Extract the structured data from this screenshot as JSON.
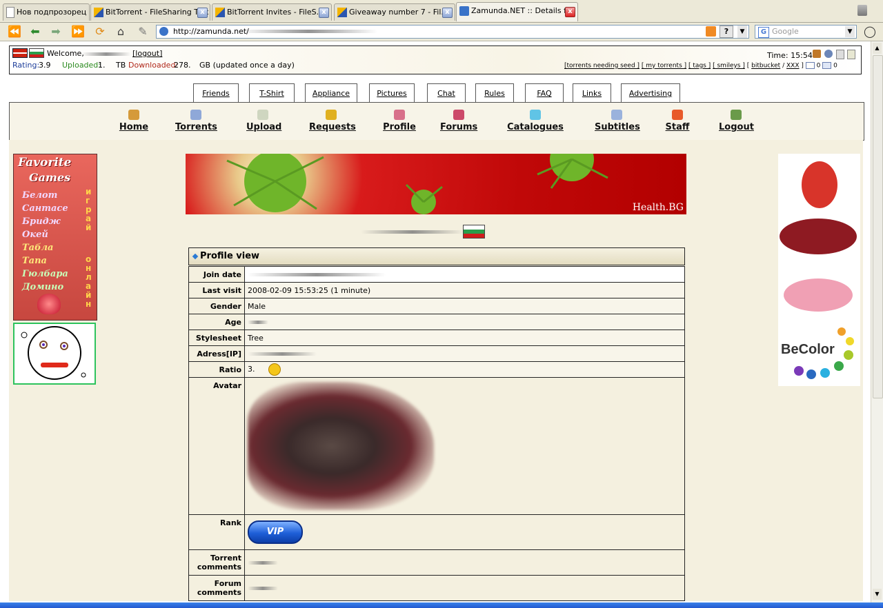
{
  "browser": {
    "tabs": [
      {
        "label": "Нов подпрозорец"
      },
      {
        "label": "BitTorrent - FileSharing Talk"
      },
      {
        "label": "BitTorrent Invites - FileS..."
      },
      {
        "label": "Giveaway number 7 - Fil..."
      },
      {
        "label": "Zamunda.NET :: Details f..."
      }
    ],
    "url": "http://zamunda.net/",
    "search_placeholder": "Google"
  },
  "header": {
    "welcome": "Welcome,",
    "logout": "[logout]",
    "rating_label": "Rating:",
    "rating_value": "3.9",
    "uploaded_label": "Uploaded:",
    "uploaded_value": "1.",
    "uploaded_unit": "TB",
    "downloaded_label": "Downloaded:",
    "downloaded_value": "278.",
    "downloaded_unit": "GB (updated once a day)",
    "time": "Time: 15:54",
    "links": [
      "[torrents needing seed ]",
      "[ my torrents ]",
      "[ tags ]",
      "[ smileys ]",
      "[",
      "bitbucket",
      "/",
      "XXX",
      "]"
    ],
    "count1": "0",
    "count2": "0"
  },
  "subtabs": [
    "Friends",
    "T-Shirt",
    "Appliance",
    "Pictures",
    "Chat",
    "Rules",
    "FAQ",
    "Links",
    "Advertising"
  ],
  "mainnav": [
    "Home",
    "Torrents",
    "Upload",
    "Requests",
    "Profile",
    "Forums",
    "Catalogues",
    "Subtitles",
    "Staff",
    "Logout"
  ],
  "left_ad": {
    "title1": "Favorite",
    "title2": "Games",
    "games": [
      "Белот",
      "Сантасе",
      "Бридж",
      "Окей",
      "Табла",
      "Тапа",
      "Гюлбара",
      "Домино"
    ],
    "side_top": "играй",
    "side_bottom": "онлайн"
  },
  "banner_brand": "Health.BG",
  "right_ad_brand": "BeColor",
  "profile": {
    "heading": "Profile view",
    "rows": [
      {
        "label": "Join date",
        "value": ""
      },
      {
        "label": "Last visit",
        "value": "2008-02-09 15:53:25 (1 minute)"
      },
      {
        "label": "Gender",
        "value": "Male"
      },
      {
        "label": "Age",
        "value": ""
      },
      {
        "label": "Stylesheet",
        "value": "Tree"
      },
      {
        "label": "Adress[IP]",
        "value": ""
      },
      {
        "label": "Ratio",
        "value": "3."
      },
      {
        "label": "Avatar",
        "value": ""
      },
      {
        "label": "Rank",
        "value": "VIP"
      },
      {
        "label": "Torrent comments",
        "value": ""
      },
      {
        "label": "Forum comments",
        "value": ""
      }
    ]
  },
  "colors": {
    "uploaded": "#2a8a1e",
    "downloaded": "#b0281a",
    "rating": "#1d3d9a"
  }
}
